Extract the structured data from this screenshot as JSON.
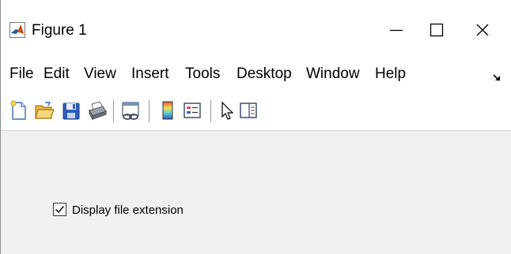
{
  "window": {
    "title": "Figure 1",
    "minimize_glyph": "—",
    "close_glyph": "✕"
  },
  "menubar": {
    "items": [
      "File",
      "Edit",
      "View",
      "Insert",
      "Tools",
      "Desktop",
      "Window",
      "Help"
    ],
    "overflow_icon": "overflow-arrow-icon"
  },
  "toolbar": {
    "buttons": [
      {
        "name": "new-figure",
        "icon": "new-document-icon"
      },
      {
        "name": "open-file",
        "icon": "open-folder-icon"
      },
      {
        "name": "save-figure",
        "icon": "save-disk-icon"
      },
      {
        "name": "print-figure",
        "icon": "printer-icon"
      },
      {
        "name": "link-plot",
        "icon": "link-plot-icon"
      },
      {
        "name": "insert-colorbar",
        "icon": "colorbar-icon"
      },
      {
        "name": "insert-legend",
        "icon": "legend-icon"
      },
      {
        "name": "edit-plot",
        "icon": "pointer-arrow-icon"
      },
      {
        "name": "show-plot-tools",
        "icon": "plot-tools-icon"
      }
    ]
  },
  "content": {
    "checkbox": {
      "label": "Display file extension",
      "checked": true
    }
  }
}
